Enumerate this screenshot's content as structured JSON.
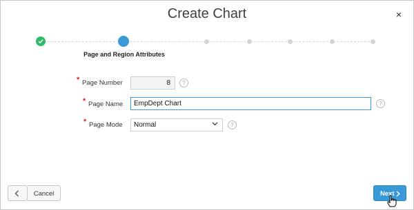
{
  "dialog": {
    "title": "Create Chart",
    "close_glyph": "×"
  },
  "wizard": {
    "current_step_label": "Page and Region Attributes",
    "steps": [
      "complete",
      "current",
      "future",
      "future",
      "future",
      "future"
    ]
  },
  "form": {
    "page_number": {
      "label": "Page Number",
      "required": true,
      "value": "8",
      "help_icon": "help-icon"
    },
    "page_name": {
      "label": "Page Name",
      "required": true,
      "value": "EmpDept Chart",
      "help_icon": "help-icon"
    },
    "page_mode": {
      "label": "Page Mode",
      "required": true,
      "value": "Normal",
      "help_icon": "help-icon"
    },
    "required_marker": "*",
    "help_glyph": "?"
  },
  "footer": {
    "back_icon": "chevron-left-icon",
    "cancel_label": "Cancel",
    "next_label": "Next",
    "next_icon": "chevron-right-icon"
  },
  "colors": {
    "accent": "#3a9ad9",
    "success": "#2ebb6a",
    "required": "#e02020"
  }
}
